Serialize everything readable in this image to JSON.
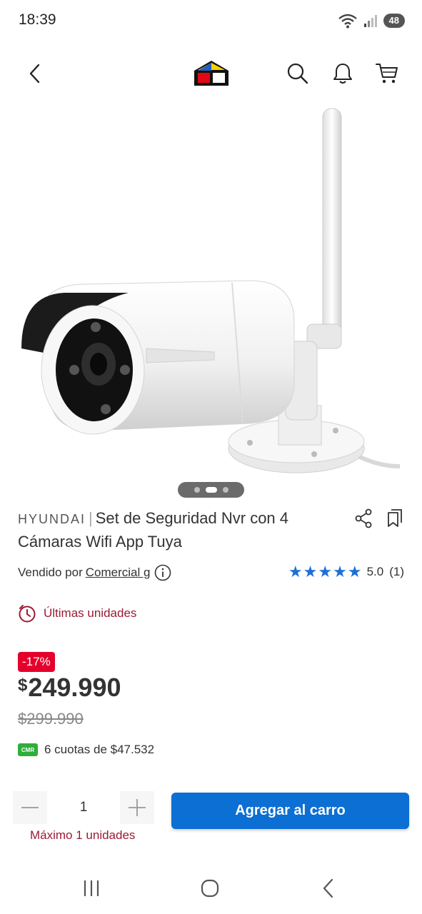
{
  "status_bar": {
    "time": "18:39",
    "battery": "48"
  },
  "product": {
    "brand": "HYUNDAI",
    "separator": "|",
    "name": "Set de Seguridad Nvr con 4 Cámaras Wifi App Tuya",
    "image_pages": 3,
    "image_current_page": 2
  },
  "seller": {
    "prefix": "Vendido por",
    "name": "Comercial g"
  },
  "rating": {
    "value": "5.0",
    "count": "(1)",
    "stars": 5
  },
  "stock": {
    "label": "Últimas unidades"
  },
  "price": {
    "discount_badge": "-17%",
    "currency": "$",
    "current": "249.990",
    "original": "$299.990",
    "cmr_badge": "CMR",
    "installments": "6 cuotas de $47.532"
  },
  "quantity": {
    "value": "1",
    "max_label": "Máximo 1 unidades"
  },
  "cart_button": {
    "label": "Agregar al carro"
  },
  "colors": {
    "primary_blue": "#0b6fd3",
    "star_blue": "#1d6fd6",
    "discount_red": "#e4002b",
    "stock_red": "#9b1b34",
    "cmr_green": "#2fae3a"
  },
  "icons": {
    "header": [
      "back-arrow-icon",
      "store-logo",
      "search-icon",
      "bell-icon",
      "cart-icon"
    ],
    "product_actions": [
      "share-icon",
      "bookmark-icon"
    ],
    "system_nav": [
      "recent-apps-icon",
      "home-icon",
      "back-icon"
    ]
  }
}
